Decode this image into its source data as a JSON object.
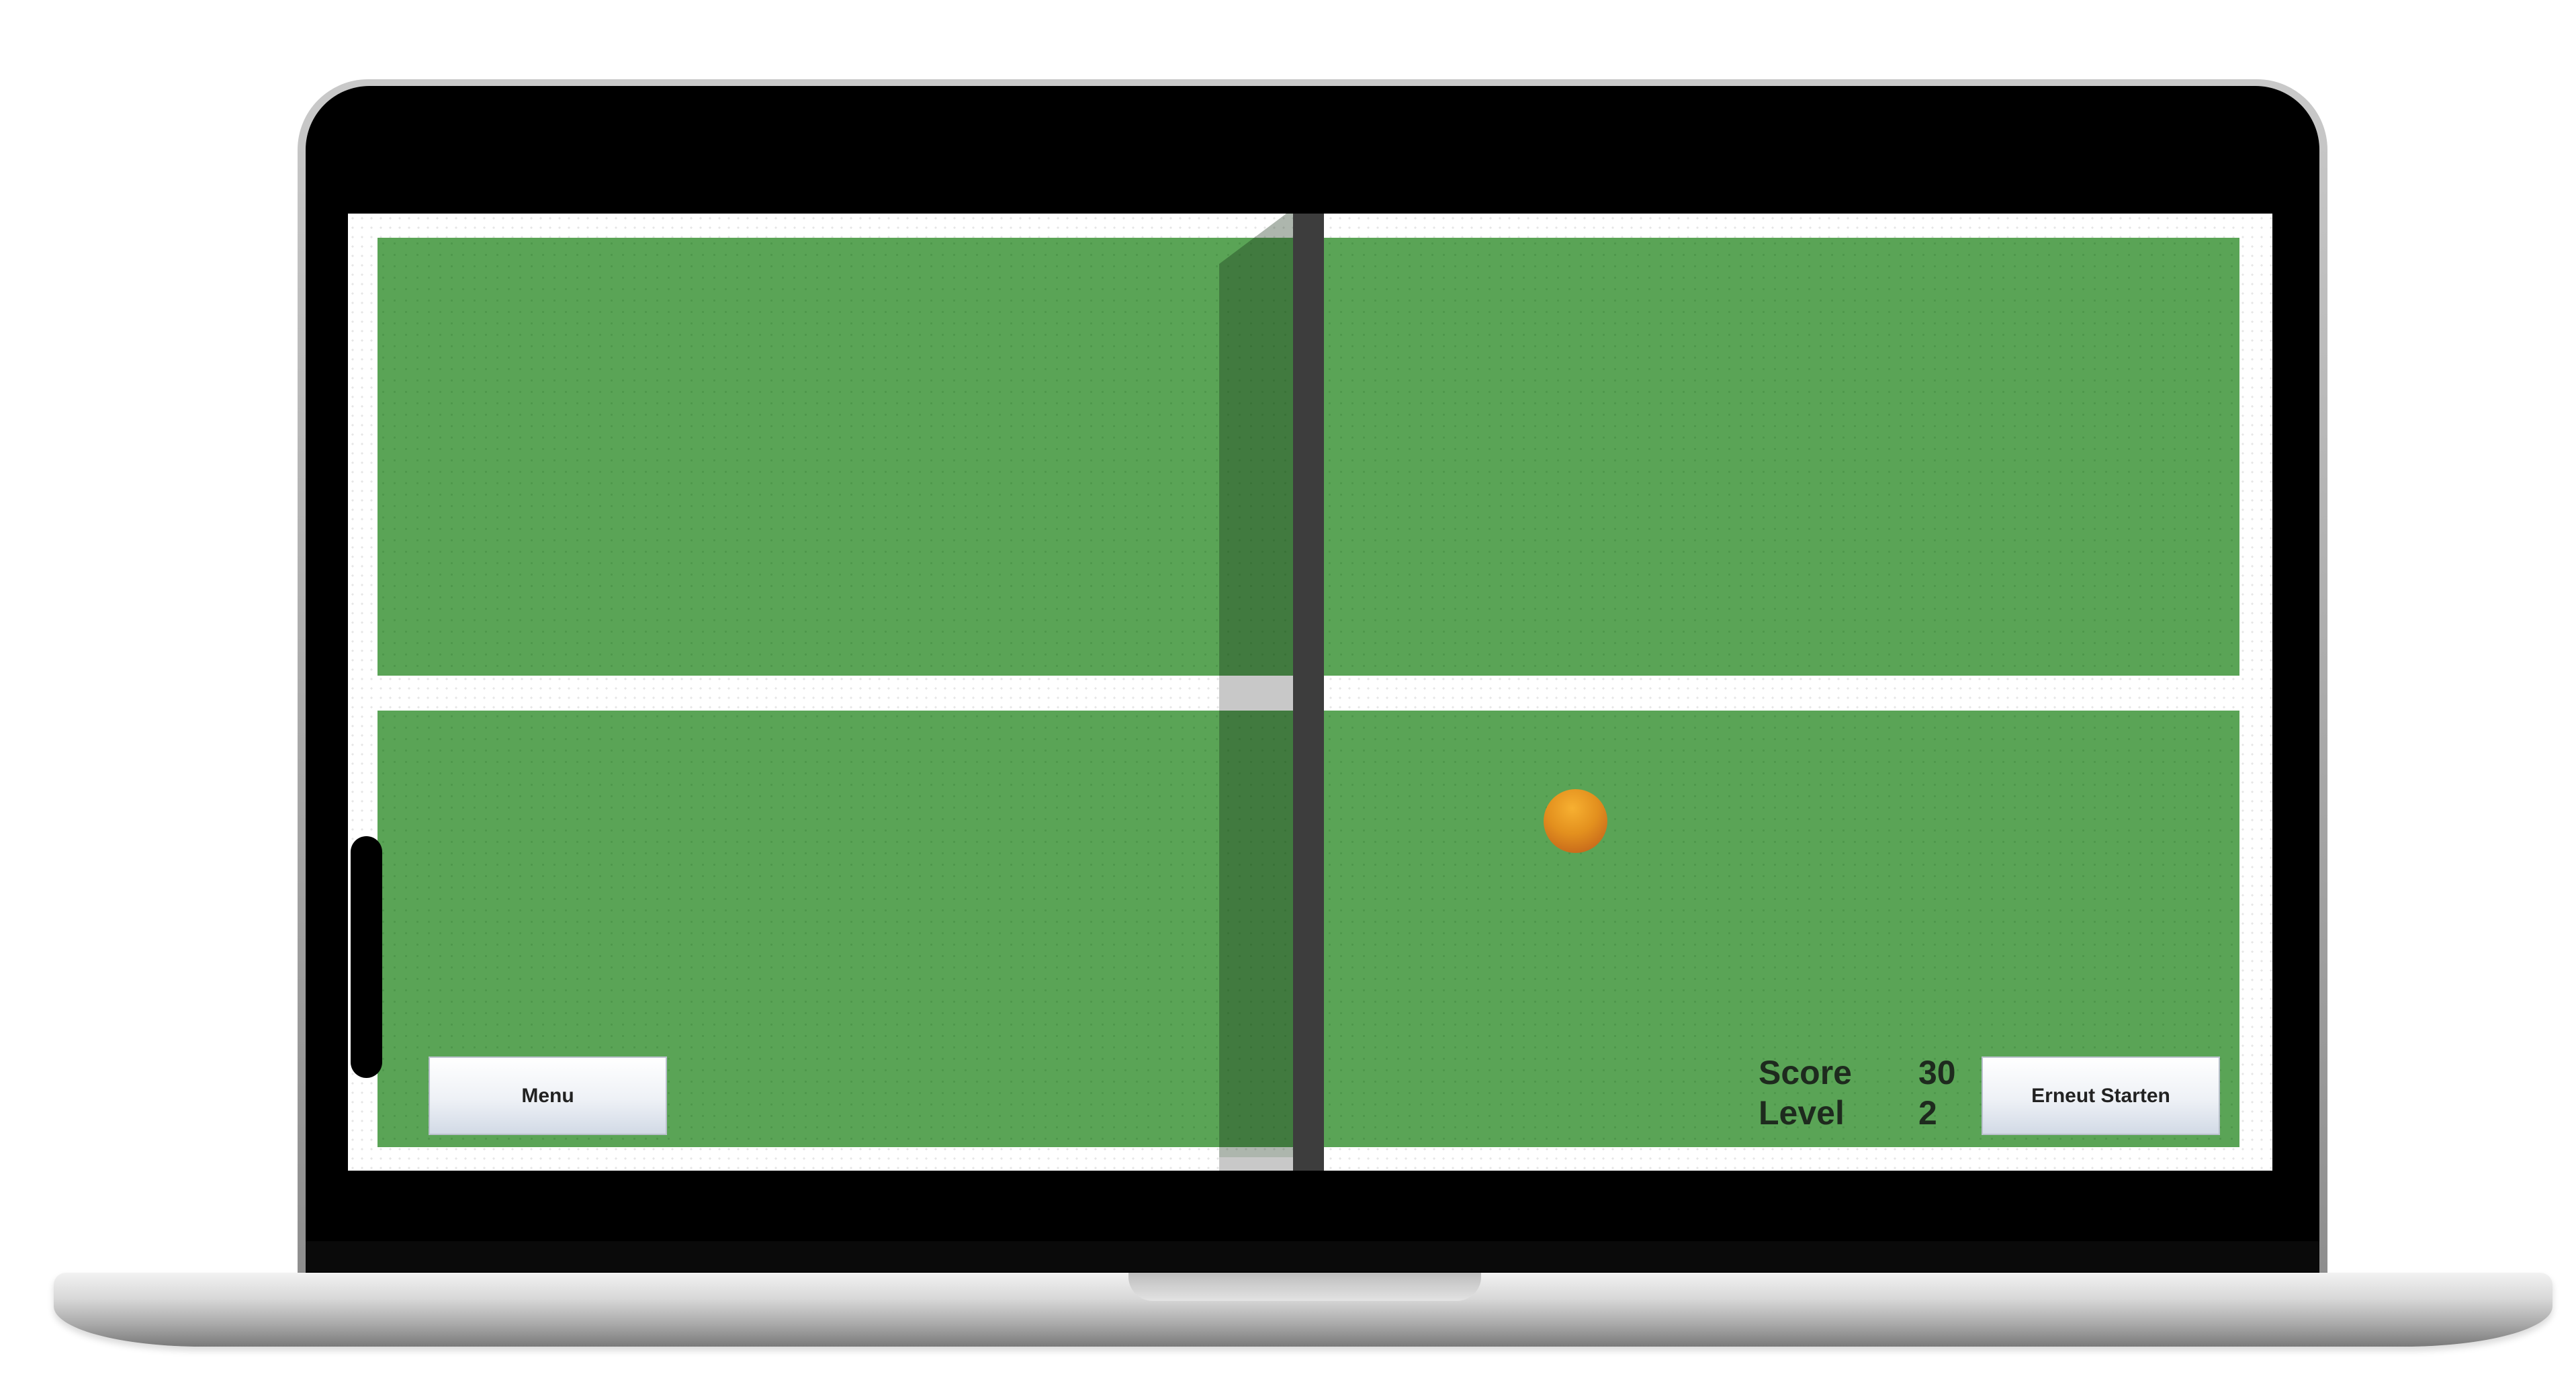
{
  "game": {
    "menu_label": "Menu",
    "restart_label": "Erneut Starten",
    "score_label": "Score",
    "score_value": "30",
    "level_label": "Level",
    "level_value": "2"
  },
  "colors": {
    "court": "#5aa456",
    "net": "#3d3d3d",
    "ball": "#e3901e",
    "paddle": "#000000"
  }
}
